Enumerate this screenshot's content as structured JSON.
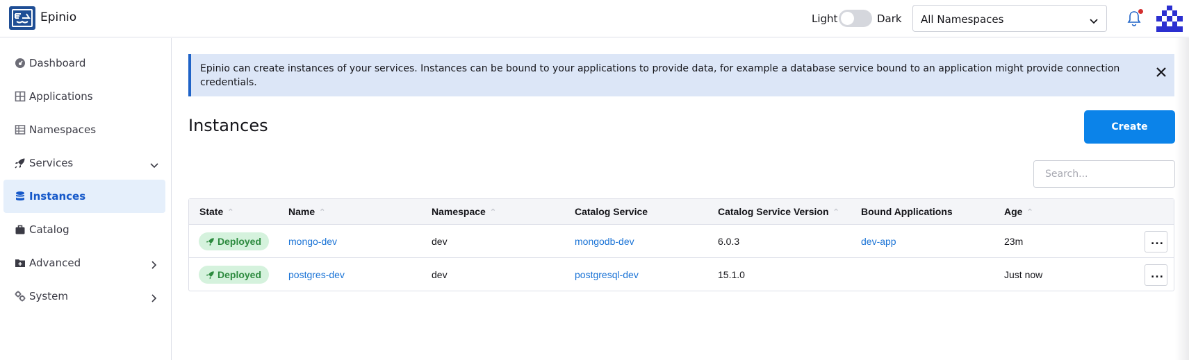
{
  "app": {
    "title": "Epinio"
  },
  "header": {
    "theme_light": "Light",
    "theme_dark": "Dark",
    "namespace_select": "All Namespaces"
  },
  "sidebar": {
    "items": [
      {
        "label": "Dashboard",
        "icon": "dashboard-icon"
      },
      {
        "label": "Applications",
        "icon": "applications-icon"
      },
      {
        "label": "Namespaces",
        "icon": "namespaces-icon"
      },
      {
        "label": "Services",
        "icon": "rocket-icon",
        "expand": "down"
      },
      {
        "label": "Instances",
        "icon": "database-icon",
        "active": true
      },
      {
        "label": "Catalog",
        "icon": "briefcase-icon"
      },
      {
        "label": "Advanced",
        "icon": "folder-plus-icon",
        "expand": "right"
      },
      {
        "label": "System",
        "icon": "cogs-icon",
        "expand": "right"
      }
    ]
  },
  "banner": {
    "text": "Epinio can create instances of your services. Instances can be bound to your applications to provide data, for example a database service bound to an application might provide connection credentials."
  },
  "main": {
    "title": "Instances",
    "create_label": "Create",
    "search_placeholder": "Search..."
  },
  "table": {
    "columns": [
      "State",
      "Name",
      "Namespace",
      "Catalog Service",
      "Catalog Service Version",
      "Bound Applications",
      "Age"
    ],
    "rows": [
      {
        "state": "Deployed",
        "name": "mongo-dev",
        "namespace": "dev",
        "catalog_service": "mongodb-dev",
        "version": "6.0.3",
        "bound": "dev-app",
        "age": "23m"
      },
      {
        "state": "Deployed",
        "name": "postgres-dev",
        "namespace": "dev",
        "catalog_service": "postgresql-dev",
        "version": "15.1.0",
        "bound": "",
        "age": "Just now"
      }
    ],
    "actions_label": "..."
  },
  "colors": {
    "primary": "#0b83e9",
    "brand": "#1f4e95",
    "active_bg": "#e5effb",
    "banner_bg": "#dce6f7",
    "deployed_bg": "#d5f2dd",
    "deployed_text": "#2c8a3e",
    "link": "#1a73d6"
  }
}
